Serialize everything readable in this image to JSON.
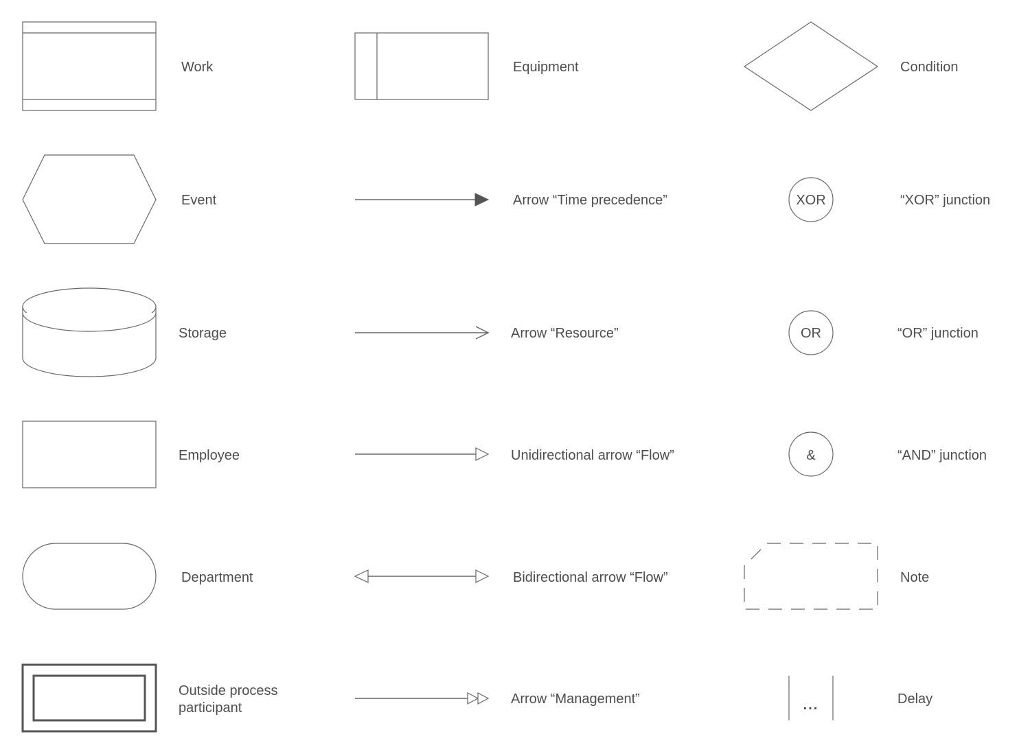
{
  "labels": {
    "work": "Work",
    "equipment": "Equipment",
    "condition": "Condition",
    "event": "Event",
    "arrow_time": "Arrow “Time precedence”",
    "xor_junction": "“XOR” junction",
    "storage": "Storage",
    "arrow_resource": "Arrow “Resource”",
    "or_junction": "“OR” junction",
    "employee": "Employee",
    "uni_flow": "Unidirectional arrow “Flow”",
    "and_junction": "“AND” junction",
    "department": "Department",
    "bi_flow": "Bidirectional arrow “Flow”",
    "note": "Note",
    "outside_line1": "Outside process",
    "outside_line2": "participant",
    "arrow_management": "Arrow “Management”",
    "delay": "Delay"
  },
  "symbols": {
    "xor": "XOR",
    "or": "OR",
    "and": "&",
    "delay": "..."
  },
  "colors": {
    "stroke": "#666666",
    "text": "#4d4d4d"
  }
}
